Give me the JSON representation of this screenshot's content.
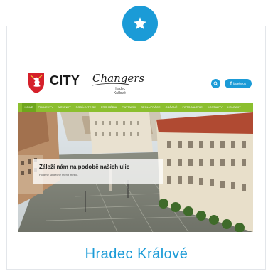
{
  "badge": {
    "icon": "star-icon",
    "color": "#1b9bd7"
  },
  "site": {
    "brand": "CITY",
    "brand_script": "Changers",
    "brand_city_line1": "Hradec",
    "brand_city_line2": "Králové",
    "facebook_label": "facebook",
    "accent": "#1b9bd7",
    "nav_color": "#8cbf2f"
  },
  "nav": {
    "items": [
      {
        "label": "Home",
        "active": true
      },
      {
        "label": "Projekty",
        "active": false
      },
      {
        "label": "Novinky",
        "active": false
      },
      {
        "label": "Podílejte se",
        "active": false
      },
      {
        "label": "Pro média",
        "active": false
      },
      {
        "label": "Partneři",
        "active": false
      },
      {
        "label": "Spolupráce",
        "active": false
      },
      {
        "label": "Občané",
        "active": false
      },
      {
        "label": "Fotogalerie",
        "active": false
      },
      {
        "label": "Kontakty",
        "active": false
      },
      {
        "label": "Kontakt",
        "active": false
      }
    ]
  },
  "hero": {
    "title": "Záleží nám na podobě našich ulic",
    "subtitle": "Pojďme společně měnit město."
  },
  "card": {
    "city_name": "Hradec Králové"
  }
}
